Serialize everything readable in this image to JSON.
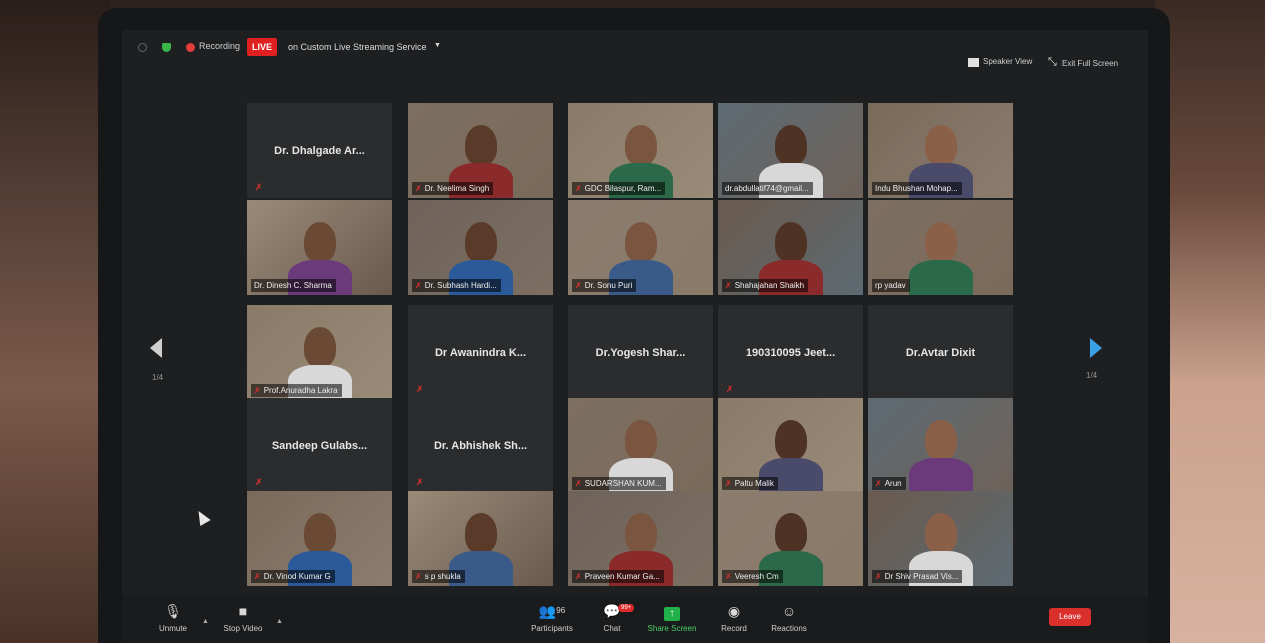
{
  "topbar": {
    "recording_label": "Recording",
    "live_badge": "LIVE",
    "stream_label": "on Custom Live Streaming Service",
    "speaker_view_label": "Speaker View",
    "exit_full_screen_label": "Exit Full Screen"
  },
  "gallery": {
    "page_indicator_prev": "1/4",
    "page_indicator_next": "1/4",
    "tiles": [
      {
        "name": "Dr. Dhalgade Ar...",
        "video": false,
        "muted": true
      },
      {
        "name": "Dr. Neelima Singh",
        "video": true,
        "muted": true
      },
      {
        "name": "GDC Bilaspur, Ram...",
        "video": true,
        "muted": true
      },
      {
        "name": "dr.abdullatif74@gmail...",
        "video": true,
        "muted": false
      },
      {
        "name": "Indu Bhushan Mohap...",
        "video": true,
        "muted": false
      },
      {
        "name": "Dr. Dinesh C. Sharma",
        "video": true,
        "muted": false,
        "active": true
      },
      {
        "name": "Dr. Subhash Hardi...",
        "video": true,
        "muted": true
      },
      {
        "name": "Dr. Sonu Puri",
        "video": true,
        "muted": true
      },
      {
        "name": "Shahajahan Shaikh",
        "video": true,
        "muted": true
      },
      {
        "name": "rp yadav",
        "video": true,
        "muted": false
      },
      {
        "name": "Prof.Anuradha Lakra",
        "video": true,
        "muted": true
      },
      {
        "name": "Dr Awanindra K...",
        "video": false,
        "muted": true
      },
      {
        "name": "Dr.Yogesh Shar...",
        "video": false,
        "muted": false
      },
      {
        "name": "190310095 Jeet...",
        "video": false,
        "muted": true
      },
      {
        "name": "Dr.Avtar Dixit",
        "video": false,
        "muted": false
      },
      {
        "name": "Sandeep Gulabs...",
        "video": false,
        "muted": true
      },
      {
        "name": "Dr. Abhishek Sh...",
        "video": false,
        "muted": true
      },
      {
        "name": "SUDARSHAN KUM...",
        "video": true,
        "muted": true
      },
      {
        "name": "Paltu Malik",
        "video": true,
        "muted": true
      },
      {
        "name": "Arun",
        "video": true,
        "muted": true
      },
      {
        "name": "Dr. Vinod Kumar G",
        "video": true,
        "muted": true
      },
      {
        "name": "s p shukla",
        "video": true,
        "muted": true
      },
      {
        "name": "Praveen Kumar Ga...",
        "video": true,
        "muted": true
      },
      {
        "name": "Veeresh Cm",
        "video": true,
        "muted": true
      },
      {
        "name": "Dr Shiv Prasad Vis...",
        "video": true,
        "muted": true
      }
    ]
  },
  "toolbar": {
    "unmute_label": "Unmute",
    "stop_video_label": "Stop Video",
    "participants_label": "Participants",
    "participants_count": "96",
    "chat_label": "Chat",
    "chat_badge": "99+",
    "share_screen_label": "Share Screen",
    "record_label": "Record",
    "reactions_label": "Reactions",
    "leave_label": "Leave"
  },
  "colors": {
    "live_red": "#e02020",
    "share_green": "#22b04a",
    "leave_red": "#d9302c",
    "active_speaker_outline": "#c9d34a",
    "next_arrow_blue": "#3aa0e8"
  }
}
